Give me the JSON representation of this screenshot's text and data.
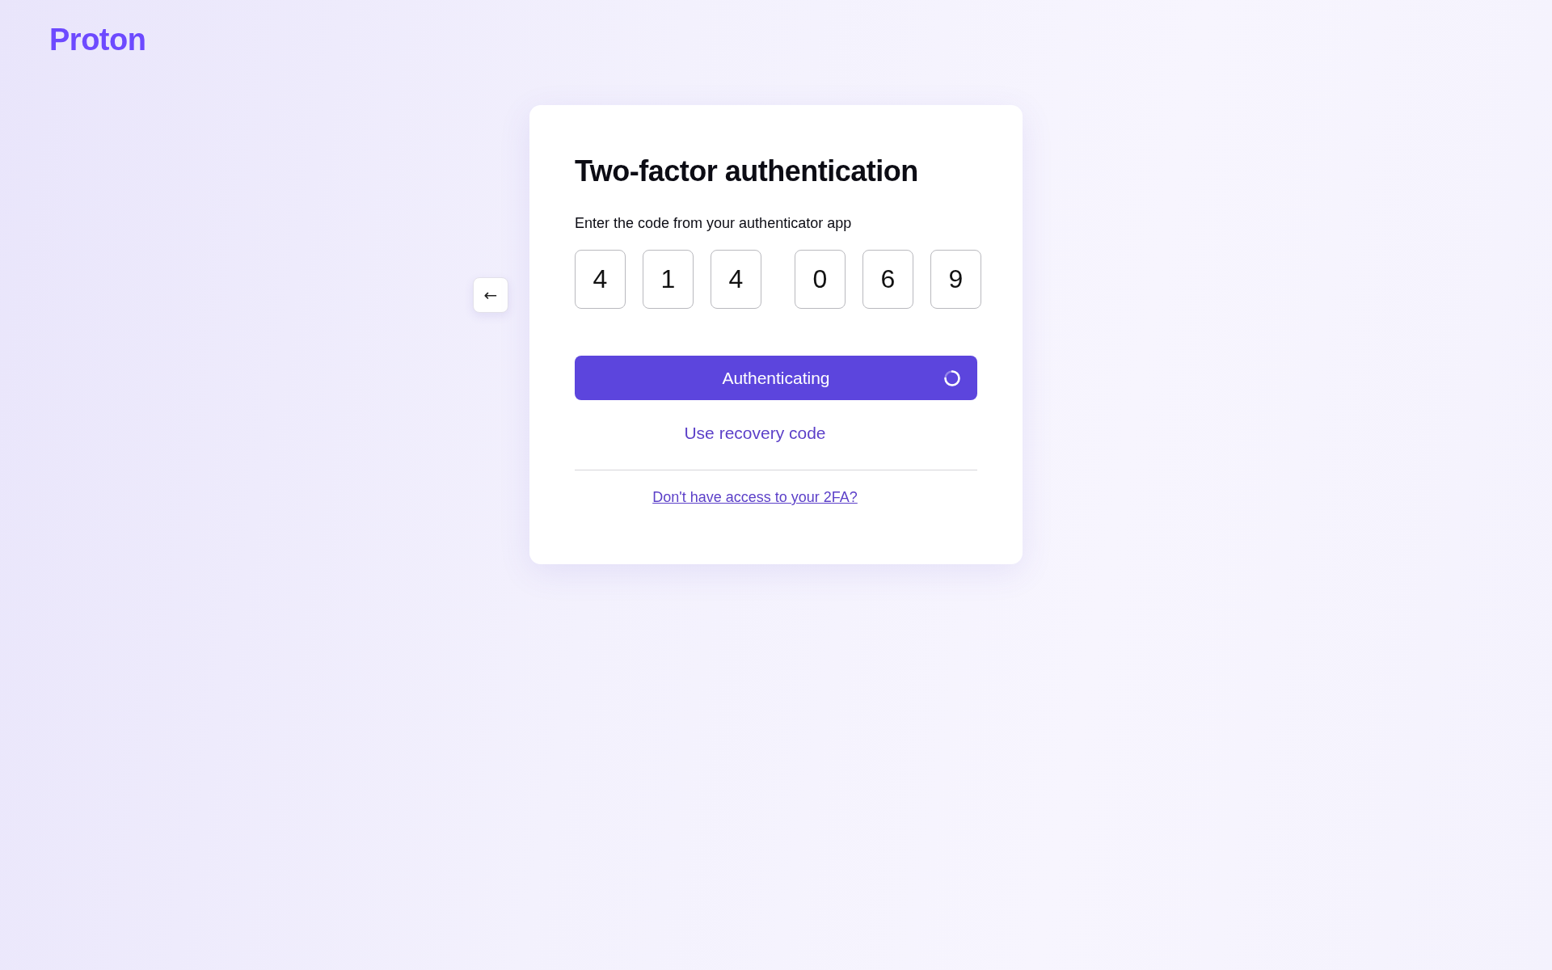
{
  "logo": {
    "text": "Proton"
  },
  "back_button": {
    "label": "←"
  },
  "card": {
    "title": "Two-factor authentication",
    "instruction": "Enter the code from your authenticator app",
    "code_groups": [
      [
        "4",
        "1",
        "4"
      ],
      [
        "0",
        "6",
        "9"
      ]
    ],
    "submit_button": {
      "label": "Authenticating",
      "loading": true
    },
    "recovery_link": "Use recovery code",
    "help_link": "Don't have access to your 2FA?"
  }
}
